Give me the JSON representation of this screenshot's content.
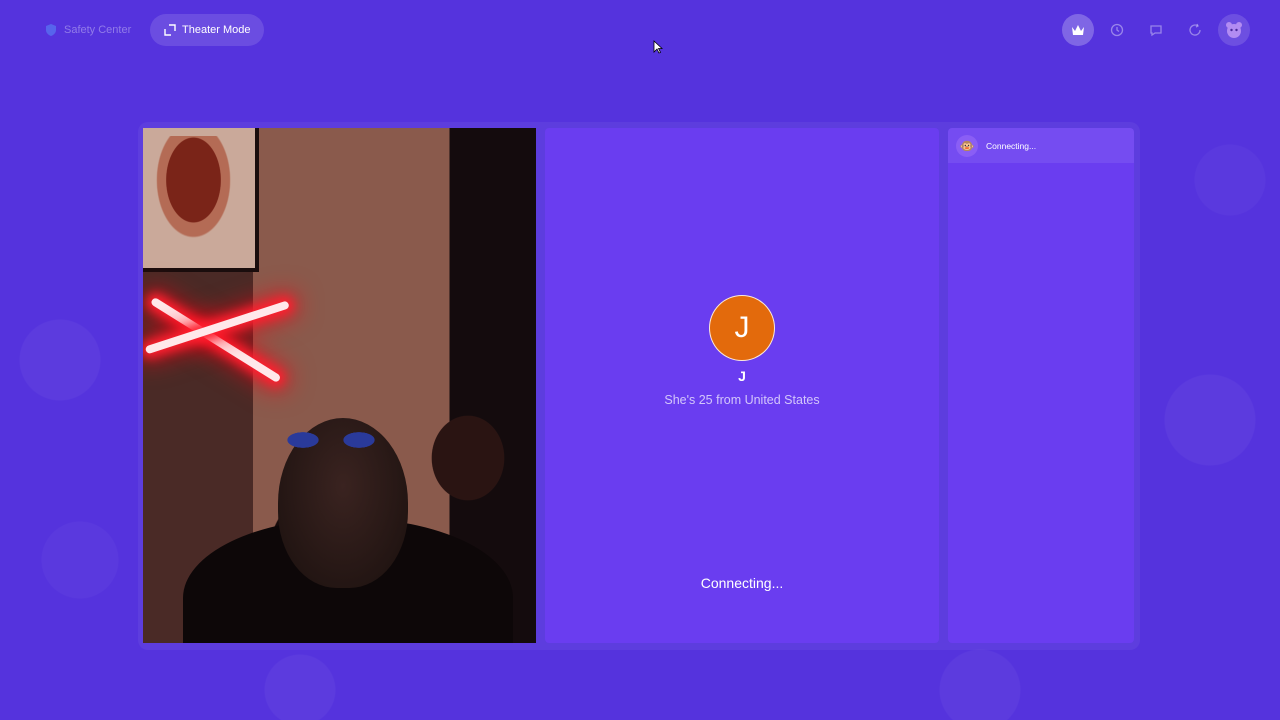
{
  "topbar": {
    "safety_label": "Safety Center",
    "theater_label": "Theater Mode",
    "icons": [
      "crown-icon",
      "history-icon",
      "chat-icon",
      "refresh-icon",
      "profile-avatar"
    ]
  },
  "partner": {
    "initial": "J",
    "name": "J",
    "description": "She's 25 from United States",
    "status": "Connecting..."
  },
  "side_panel": {
    "header_status": "Connecting...",
    "avatar_emoji": "🐵"
  },
  "colors": {
    "background": "#5533dd",
    "panel": "#6a3df0",
    "avatar": "#e36a0c"
  }
}
